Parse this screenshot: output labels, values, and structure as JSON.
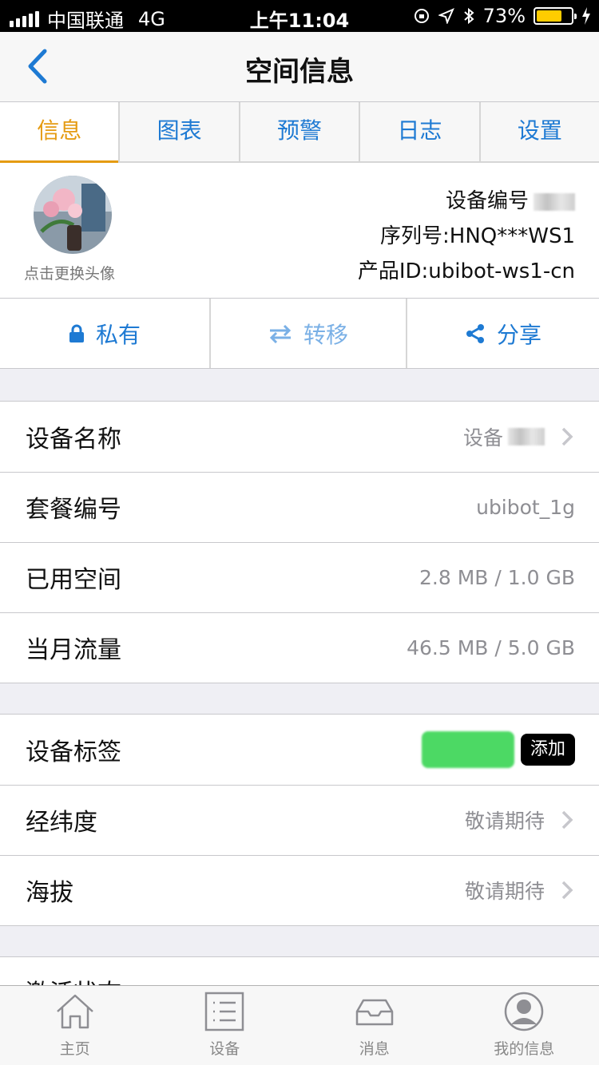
{
  "status_bar": {
    "carrier": "中国联通",
    "network": "4G",
    "time": "上午11:04",
    "battery": "73%",
    "battery_level": 0.73
  },
  "nav": {
    "title": "空间信息"
  },
  "tabs": [
    {
      "label": "信息",
      "active": true
    },
    {
      "label": "图表"
    },
    {
      "label": "预警"
    },
    {
      "label": "日志"
    },
    {
      "label": "设置"
    }
  ],
  "device": {
    "avatar_caption": "点击更换头像",
    "device_number_label": "设备编号",
    "serial": "序列号:HNQ***WS1",
    "product_id": "产品ID:ubibot-ws1-cn"
  },
  "actions": [
    {
      "label": "私有",
      "icon": "lock-icon"
    },
    {
      "label": "转移",
      "icon": "transfer-icon"
    },
    {
      "label": "分享",
      "icon": "share-icon"
    }
  ],
  "info_rows": [
    {
      "label": "设备名称",
      "value": "设备",
      "chevron": true
    },
    {
      "label": "套餐编号",
      "value": "ubibot_1g"
    },
    {
      "label": "已用空间",
      "value": "2.8 MB / 1.0 GB"
    },
    {
      "label": "当月流量",
      "value": "46.5 MB / 5.0 GB"
    }
  ],
  "meta_rows": {
    "tag_label": "设备标签",
    "add_label": "添加",
    "location_label": "经纬度",
    "location_value": "敬请期待",
    "altitude_label": "海拔",
    "altitude_value": "敬请期待"
  },
  "partial_row": {
    "label": "激活状态"
  },
  "tab_bar": [
    {
      "label": "主页",
      "icon": "home-icon"
    },
    {
      "label": "设备",
      "icon": "device-list-icon"
    },
    {
      "label": "消息",
      "icon": "inbox-icon"
    },
    {
      "label": "我的信息",
      "icon": "profile-icon"
    }
  ],
  "colors": {
    "accent_blue": "#1e7ad3",
    "active_orange": "#e59b12",
    "tag_green": "#4cd964"
  }
}
